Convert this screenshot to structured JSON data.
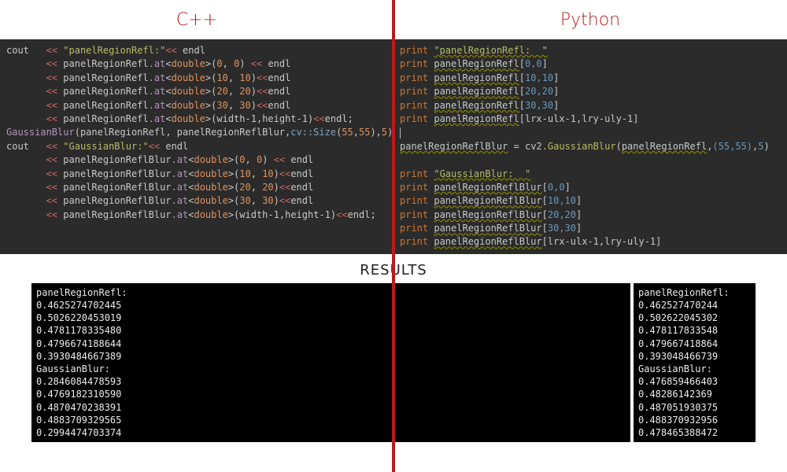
{
  "headers": {
    "left": "C++",
    "right": "Python"
  },
  "results_label": "RESULTS",
  "cpp": {
    "l1a": "cout",
    "l1b": "<<",
    "l1c": "\"panelRegionRefl:\"",
    "l1d": "endl",
    "obj1": "panelRegionRefl",
    "method": ".at",
    "dtype": "double",
    "idx00a": "0",
    "idx00b": "0",
    "idx10a": "10",
    "idx10b": "10",
    "idx20a": "20",
    "idx20b": "20",
    "idx30a": "30",
    "idx30b": "30",
    "wexpr": "width-1",
    "hexpr": "height-1",
    "gbfn": "GaussianBlur",
    "gbargs_a": "panelRegionRefl",
    "gbargs_b": "panelRegionReflBlur",
    "cvsize": "cv::Size",
    "sz55a": "55",
    "sz55b": "55",
    "sigma": "5",
    "l2c": "\"GaussianBlur:\"",
    "obj2": "panelRegionReflBlur"
  },
  "py": {
    "kw": "print",
    "s1": "\"panelRegionRefl:  \"",
    "s2": "\"GaussianBlur:  \"",
    "v1": "panelRegionRefl",
    "v2": "panelRegionReflBlur",
    "i00": "0,0",
    "i10": "10,10",
    "i20": "20,20",
    "i30": "30,30",
    "iexpr": "lrx-ulx-1,lry-uly-1",
    "assign_lhs": "panelRegionReflBlur",
    "cv2": "cv2",
    "gbfn": ".GaussianBlur",
    "argA": "panelRegionRefl",
    "argB": "(55,55)",
    "argC": "5"
  },
  "results_left": {
    "h1": "panelRegionRefl:",
    "r1": "0.4625274702445",
    "r2": "0.5026220453019",
    "r3": "0.4781178335480",
    "r4": "0.4796674188644",
    "r5": "0.3930484667389",
    "h2": "GaussianBlur:",
    "r6": "0.2846084478593",
    "r7": "0.4769182310590",
    "r8": "0.4870470238391",
    "r9": "0.4883709329565",
    "r10": "0.2994474703374"
  },
  "results_right": {
    "h1": "panelRegionRefl:",
    "r1": "0.462527470244",
    "r2": "0.502622045302",
    "r3": "0.478117833548",
    "r4": "0.479667418864",
    "r5": "0.393048466739",
    "h2": "GaussianBlur:",
    "r6": "0.476859466403",
    "r7": "0.48286142369",
    "r8": "0.487051930375",
    "r9": "0.488370932956",
    "r10": "0.478465388472"
  }
}
